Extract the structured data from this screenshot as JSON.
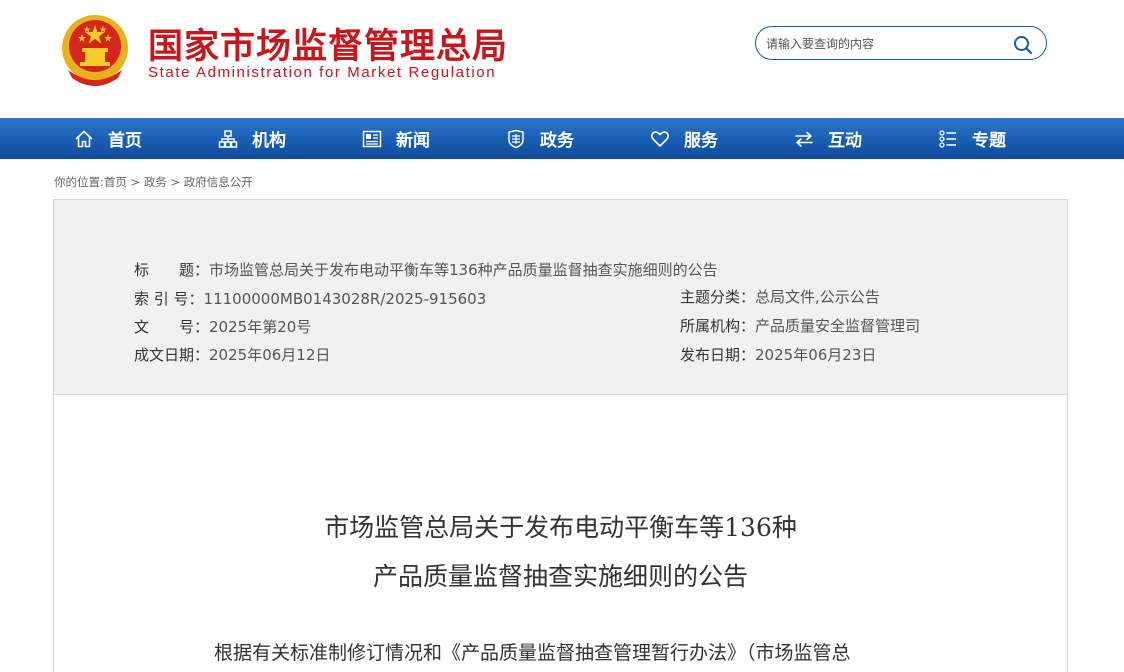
{
  "header": {
    "title_cn": "国家市场监督管理总局",
    "title_en": "State Administration for Market Regulation",
    "search": {
      "placeholder": "请输入要查询的内容"
    }
  },
  "nav": {
    "items": [
      {
        "label": "首页",
        "icon": "home-icon"
      },
      {
        "label": "机构",
        "icon": "org-chart-icon"
      },
      {
        "label": "新闻",
        "icon": "newspaper-icon"
      },
      {
        "label": "政务",
        "icon": "government-icon"
      },
      {
        "label": "服务",
        "icon": "heart-icon"
      },
      {
        "label": "互动",
        "icon": "exchange-arrows-icon"
      },
      {
        "label": "专题",
        "icon": "topics-list-icon"
      }
    ]
  },
  "breadcrumb": {
    "prefix": "你的位置:",
    "items": [
      "首页",
      "政务",
      "政府信息公开"
    ],
    "separator": ">"
  },
  "meta": {
    "title_label": "标　　题：",
    "title_value": "市场监管总局关于发布电动平衡车等136种产品质量监督抽查实施细则的公告",
    "index_label": "索 引 号：",
    "index_value": "11100000MB0143028R/2025-915603",
    "category_label": "主题分类：",
    "category_value": "总局文件,公示公告",
    "doc_no_label": "文　　号：",
    "doc_no_value": "2025年第20号",
    "org_label": "所属机构：",
    "org_value": "产品质量安全监督管理司",
    "created_label": "成文日期：",
    "created_value": "2025年06月12日",
    "published_label": "发布日期：",
    "published_value": "2025年06月23日"
  },
  "article": {
    "title_line1": "市场监管总局关于发布电动平衡车等136种",
    "title_line2": "产品质量监督抽查实施细则的公告",
    "body_first_line": "根据有关标准制修订情况和《产品质量监督抽查管理暂行办法》（市场监管总"
  },
  "colors": {
    "brand_red": "#c8161d",
    "nav_blue": "#1a5db2",
    "meta_bg": "#f1f1f1"
  }
}
